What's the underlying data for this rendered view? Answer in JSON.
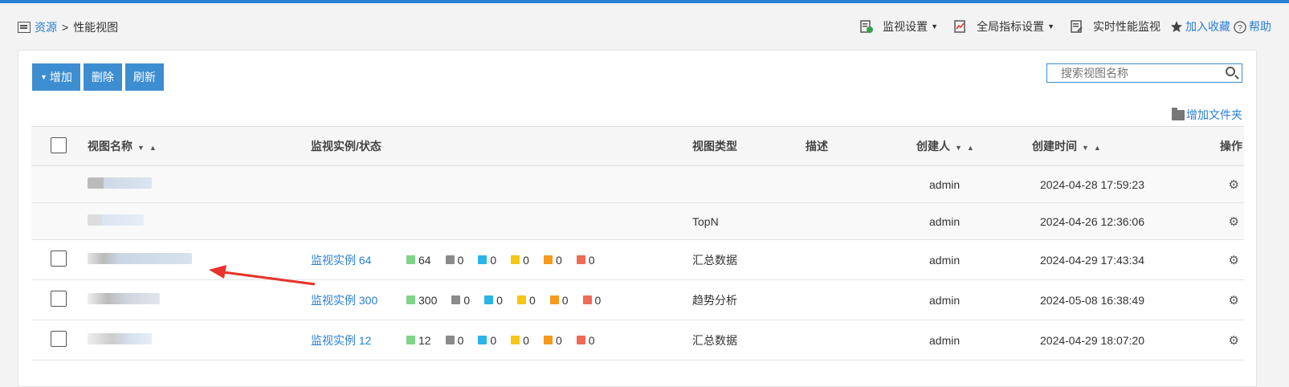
{
  "breadcrumb": {
    "root": "资源",
    "separator": ">",
    "current": "性能视图"
  },
  "toolbar": {
    "monitor_settings": "监视设置",
    "global_indicator_settings": "全局指标设置",
    "realtime_monitor": "实时性能监视",
    "add_favorite": "加入收藏",
    "help": "帮助"
  },
  "actions": {
    "add": "增加",
    "delete": "删除",
    "refresh": "刷新",
    "add_folder": "增加文件夹"
  },
  "search": {
    "placeholder": "搜索视图名称"
  },
  "table": {
    "headers": {
      "name": "视图名称",
      "instances": "监视实例/状态",
      "type": "视图类型",
      "desc": "描述",
      "creator": "创建人",
      "created": "创建时间",
      "ops": "操作"
    },
    "rows": [
      {
        "instances_label": "",
        "counts": [],
        "type": "",
        "creator": "admin",
        "created": "2024-04-28 17:59:23"
      },
      {
        "instances_label": "",
        "counts": [],
        "type": "TopN",
        "creator": "admin",
        "created": "2024-04-26 12:36:06"
      },
      {
        "instances_label": "监视实例 64",
        "counts": [
          "64",
          "0",
          "0",
          "0",
          "0",
          "0"
        ],
        "type": "汇总数据",
        "creator": "admin",
        "created": "2024-04-29 17:43:34"
      },
      {
        "instances_label": "监视实例 300",
        "counts": [
          "300",
          "0",
          "0",
          "0",
          "0",
          "0"
        ],
        "type": "趋势分析",
        "creator": "admin",
        "created": "2024-05-08 16:38:49"
      },
      {
        "instances_label": "监视实例 12",
        "counts": [
          "12",
          "0",
          "0",
          "0",
          "0",
          "0"
        ],
        "type": "汇总数据",
        "creator": "admin",
        "created": "2024-04-29 18:07:20"
      }
    ]
  },
  "colors": {
    "accent": "#2a7fd4",
    "button": "#3d8ed1",
    "status": [
      "#7fd48a",
      "#8a8a8a",
      "#2bb5e6",
      "#f5c518",
      "#f59a1a",
      "#ef6a5a"
    ],
    "arrow": "#e8322a"
  }
}
